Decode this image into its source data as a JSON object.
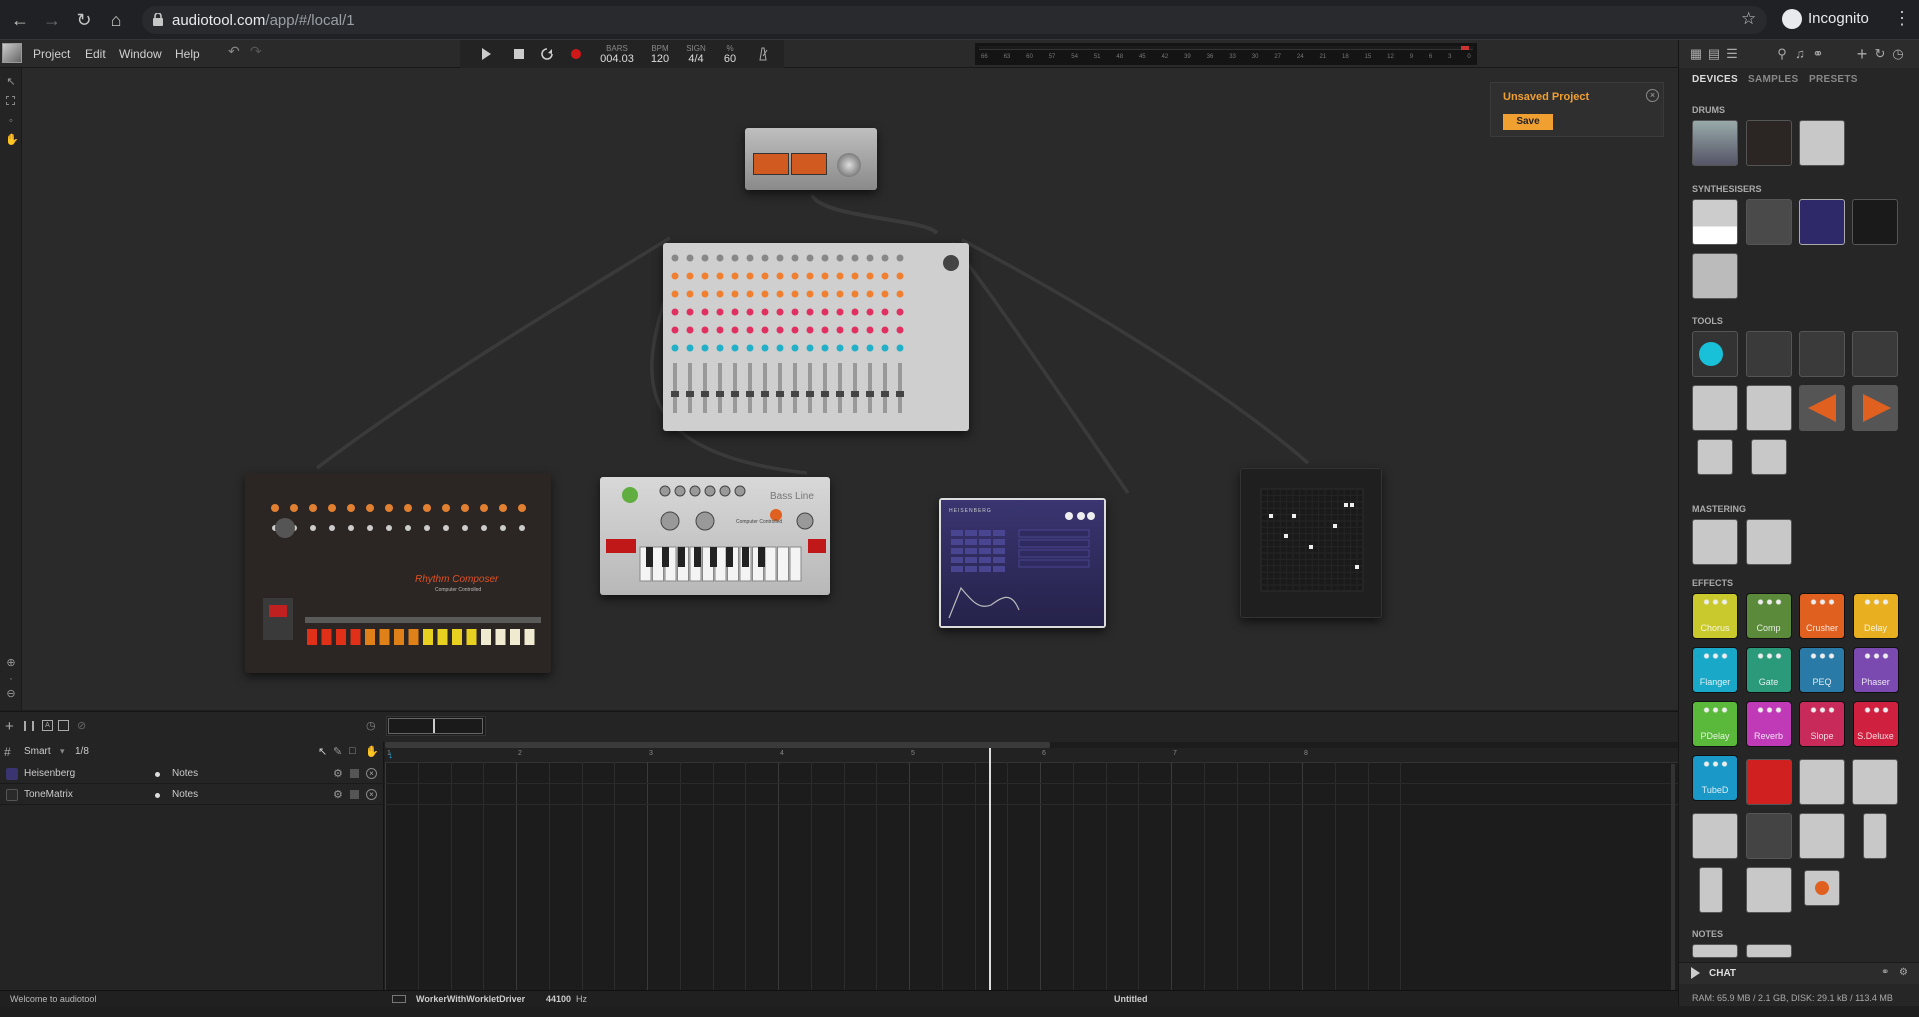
{
  "browser": {
    "url_host": "audiotool.com",
    "url_path": "/app/#/local/1",
    "profile": "Incognito"
  },
  "menu": [
    "Project",
    "Edit",
    "Window",
    "Help"
  ],
  "transport": {
    "bars_label": "BARS",
    "bars_value": "004.03",
    "bpm_label": "BPM",
    "bpm_value": "120",
    "sign_label": "SIGN",
    "sign_value": "4/4",
    "percent_label": "%",
    "percent_value": "60"
  },
  "meter_ticks": [
    "66",
    "63",
    "60",
    "57",
    "54",
    "51",
    "48",
    "45",
    "42",
    "39",
    "36",
    "33",
    "30",
    "27",
    "24",
    "21",
    "18",
    "15",
    "12",
    "9",
    "6",
    "3",
    "0"
  ],
  "unsaved": {
    "title": "Unsaved Project",
    "save": "Save"
  },
  "right_panel": {
    "tabs": [
      "DEVICES",
      "SAMPLES",
      "PRESETS"
    ],
    "categories": [
      "DRUMS",
      "SYNTHESISERS",
      "TOOLS",
      "MASTERING",
      "EFFECTS",
      "NOTES"
    ],
    "effects": [
      {
        "label": "Chorus",
        "color": "#c9c92e"
      },
      {
        "label": "Comp",
        "color": "#5a8a3a"
      },
      {
        "label": "Crusher",
        "color": "#e06020"
      },
      {
        "label": "Delay",
        "color": "#e8b020"
      },
      {
        "label": "Flanger",
        "color": "#1aa8c8"
      },
      {
        "label": "Gate",
        "color": "#2a9a7a"
      },
      {
        "label": "PEQ",
        "color": "#2a7aa8"
      },
      {
        "label": "Phaser",
        "color": "#7a4ab0"
      },
      {
        "label": "PDelay",
        "color": "#5ab83a"
      },
      {
        "label": "Reverb",
        "color": "#c03ab8"
      },
      {
        "label": "Slope",
        "color": "#c82a5a"
      },
      {
        "label": "S.Deluxe",
        "color": "#d02040"
      },
      {
        "label": "TubeD",
        "color": "#1a98c8"
      }
    ],
    "chat": "CHAT",
    "resources": "RAM: 65.9 MB / 2.1 GB, DISK: 29.1 kB / 113.4 MB"
  },
  "sequencer": {
    "mode": "Smart",
    "quantize": "1/8",
    "tracks": [
      {
        "name": "Heisenberg",
        "type": "Notes"
      },
      {
        "name": "ToneMatrix",
        "type": "Notes"
      }
    ],
    "bars": [
      "1",
      "2",
      "3",
      "4",
      "5",
      "6",
      "7",
      "8"
    ]
  },
  "status": {
    "welcome": "Welcome to audiotool",
    "driver": "WorkerWithWorkletDriver",
    "rate": "44100",
    "rate_unit": "Hz",
    "project_name": "Untitled"
  },
  "devices": [
    "Rhythm Composer",
    "Bass Line",
    "Heisenberg",
    "ToneMatrix",
    "Mixer",
    "Master"
  ],
  "device_texts": {
    "machine_808": "Rhythm Composer",
    "machine_808_sub": "Computer Controlled",
    "machine_303": "Bass Line",
    "machine_303_sub": "Computer Controlled",
    "heisenberg": "HEISENBERG"
  }
}
